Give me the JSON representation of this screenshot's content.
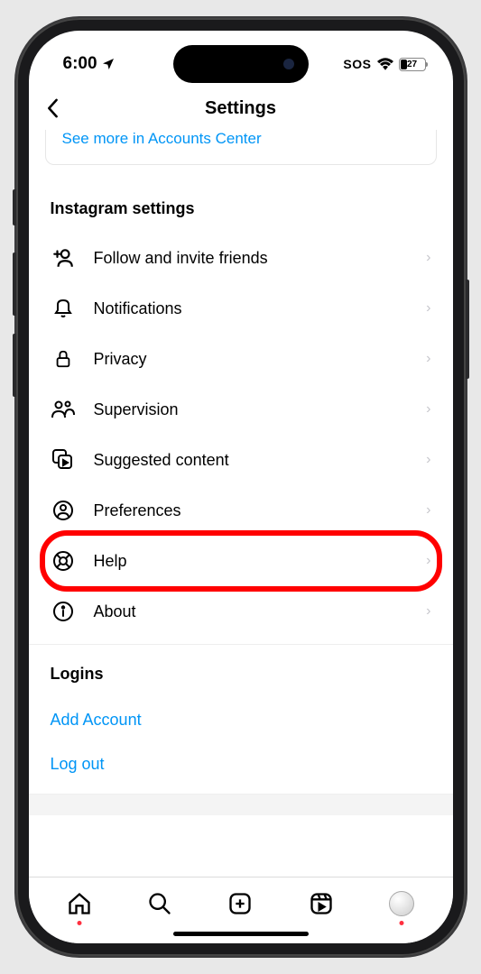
{
  "status_bar": {
    "time": "6:00",
    "sos": "SOS",
    "battery": "27"
  },
  "nav": {
    "title": "Settings"
  },
  "banner": {
    "link": "See more in Accounts Center"
  },
  "sections": {
    "title": "Instagram settings",
    "items": [
      {
        "icon": "follow-invite-icon",
        "label": "Follow and invite friends"
      },
      {
        "icon": "bell-icon",
        "label": "Notifications"
      },
      {
        "icon": "lock-icon",
        "label": "Privacy"
      },
      {
        "icon": "supervision-icon",
        "label": "Supervision"
      },
      {
        "icon": "suggested-icon",
        "label": "Suggested content"
      },
      {
        "icon": "preferences-icon",
        "label": "Preferences"
      },
      {
        "icon": "help-icon",
        "label": "Help"
      },
      {
        "icon": "about-icon",
        "label": "About"
      }
    ]
  },
  "logins": {
    "title": "Logins",
    "add": "Add Account",
    "logout": "Log out"
  },
  "tabs": [
    "home",
    "search",
    "create",
    "reels",
    "profile"
  ],
  "highlighted_row": "Help"
}
